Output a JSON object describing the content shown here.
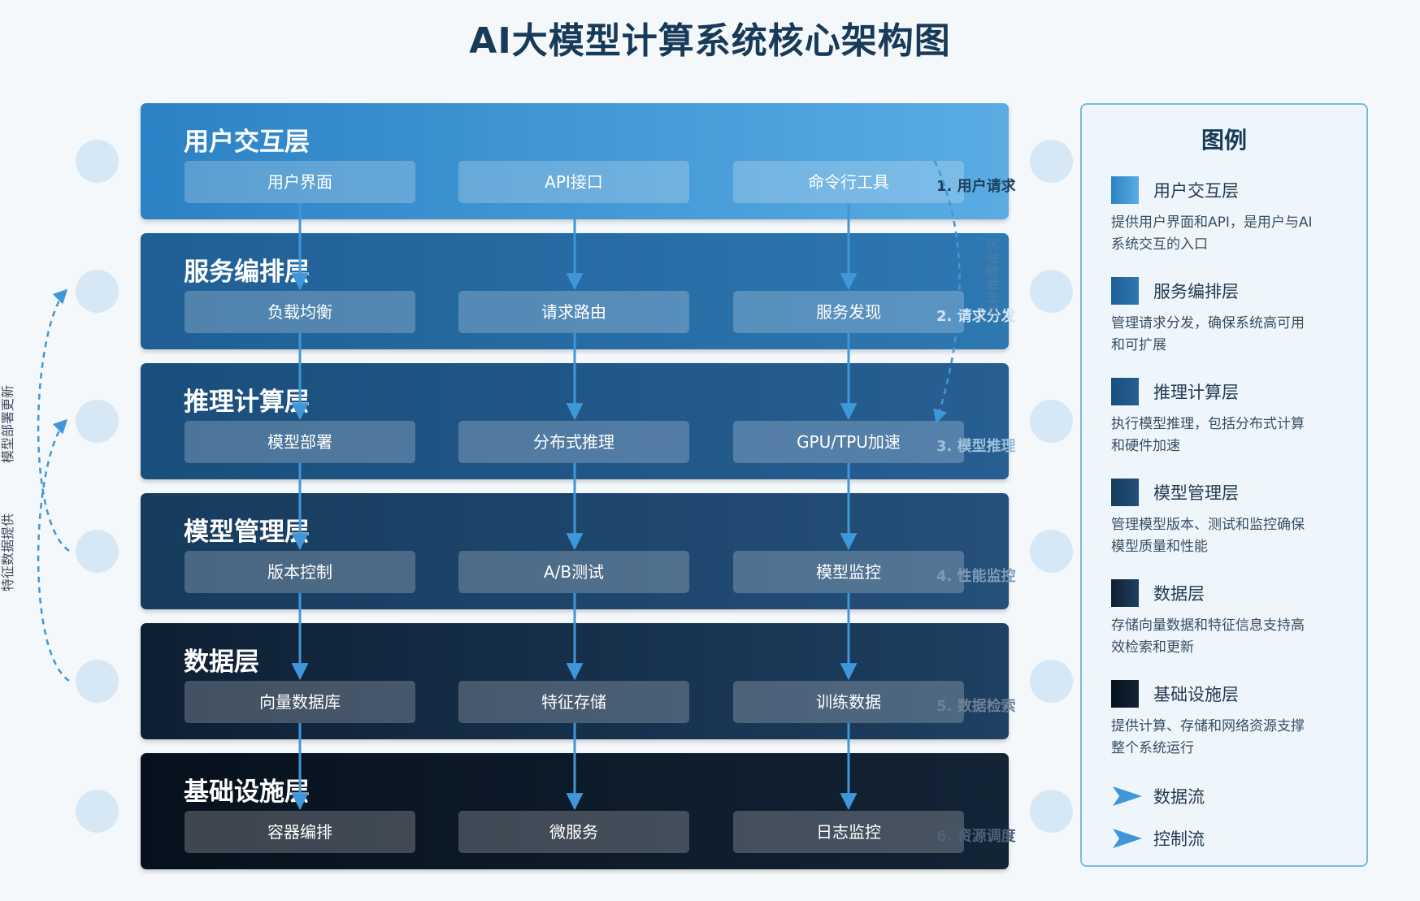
{
  "title": "AI大模型计算系统核心架构图",
  "layers": [
    {
      "name": "用户交互层",
      "items": [
        "用户界面",
        "API接口",
        "命令行工具"
      ],
      "step": "1. 用户请求"
    },
    {
      "name": "服务编排层",
      "items": [
        "负载均衡",
        "请求路由",
        "服务发现"
      ],
      "step": "2. 请求分发"
    },
    {
      "name": "推理计算层",
      "items": [
        "模型部署",
        "分布式推理",
        "GPU/TPU加速"
      ],
      "step": "3. 模型推理"
    },
    {
      "name": "模型管理层",
      "items": [
        "版本控制",
        "A/B测试",
        "模型监控"
      ],
      "step": "4. 性能监控"
    },
    {
      "name": "数据层",
      "items": [
        "向量数据库",
        "特征存储",
        "训练数据"
      ],
      "step": "5. 数据检索"
    },
    {
      "name": "基础设施层",
      "items": [
        "容器编排",
        "微服务",
        "日志监控"
      ],
      "step": "6. 资源调度"
    }
  ],
  "side_labels": {
    "right_vertical": "直接推理请求",
    "left_top": "模型部署更新",
    "left_bottom": "特征数据提供"
  },
  "legend": {
    "title": "图例",
    "items": [
      {
        "label": "用户交互层",
        "desc": "提供用户界面和API，是用户与AI系统交互的入口"
      },
      {
        "label": "服务编排层",
        "desc": "管理请求分发，确保系统高可用和可扩展"
      },
      {
        "label": "推理计算层",
        "desc": "执行模型推理，包括分布式计算和硬件加速"
      },
      {
        "label": "模型管理层",
        "desc": "管理模型版本、测试和监控确保模型质量和性能"
      },
      {
        "label": "数据层",
        "desc": "存储向量数据和特征信息支持高效检索和更新"
      },
      {
        "label": "基础设施层",
        "desc": "提供计算、存储和网络资源支撑整个系统运行"
      }
    ],
    "flows": [
      {
        "label": "数据流",
        "icon": "triangle-arrow-icon"
      },
      {
        "label": "控制流",
        "icon": "triangle-arrow-icon"
      }
    ]
  },
  "colors": {
    "layer_gradients": [
      [
        "#2b82c4",
        "#5aace3"
      ],
      [
        "#1f5f95",
        "#2e78b2"
      ],
      [
        "#1a4e7c",
        "#275f93"
      ],
      [
        "#163b5d",
        "#24507a"
      ],
      [
        "#0e1f33",
        "#1e4062"
      ],
      [
        "#07111d",
        "#132436"
      ]
    ],
    "arrow": "#3f97d9",
    "circle": "#d6e7f6"
  }
}
